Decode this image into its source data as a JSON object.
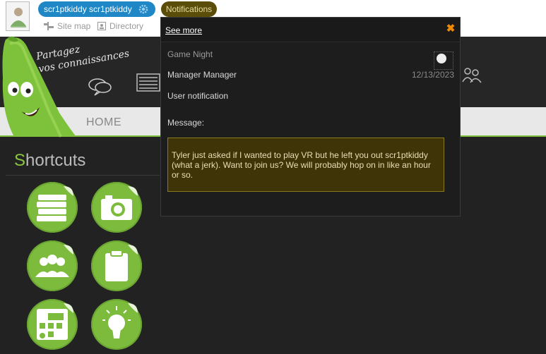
{
  "topbar": {
    "username": "scr1ptkiddy scr1ptkiddy",
    "notifications_label": "Notifications",
    "links": [
      {
        "label": "Site map",
        "icon": "sitemap-icon"
      },
      {
        "label": "Directory",
        "icon": "directory-icon"
      }
    ]
  },
  "banner": {
    "slogan_line1": "Partagez",
    "slogan_line2": "vos connaissances"
  },
  "nav": {
    "home_label": "HOME"
  },
  "shortcuts": {
    "title_first": "S",
    "title_rest": "hortcuts",
    "items": [
      {
        "icon": "books-icon"
      },
      {
        "icon": "camera-icon"
      },
      {
        "icon": "group-icon"
      },
      {
        "icon": "clipboard-icon"
      },
      {
        "icon": "calendar-icon"
      },
      {
        "icon": "lightbulb-icon"
      }
    ]
  },
  "popup": {
    "see_more": "See more",
    "close_icon": "close-icon",
    "title": "Game Night",
    "sender": "Manager Manager",
    "date": "12/13/2023",
    "type": "User notification",
    "message_label": "Message:",
    "message": "Tyler just asked if I wanted to play VR but he left you out scr1ptkiddy (what a jerk). Want to join us? We will probably hop on in like an hour or so."
  },
  "colors": {
    "accent_green": "#8cc63f",
    "user_pill": "#1f87c6",
    "notif_pill": "#5a4d0a",
    "close": "#f08a00",
    "message_bg": "#3f3407"
  }
}
